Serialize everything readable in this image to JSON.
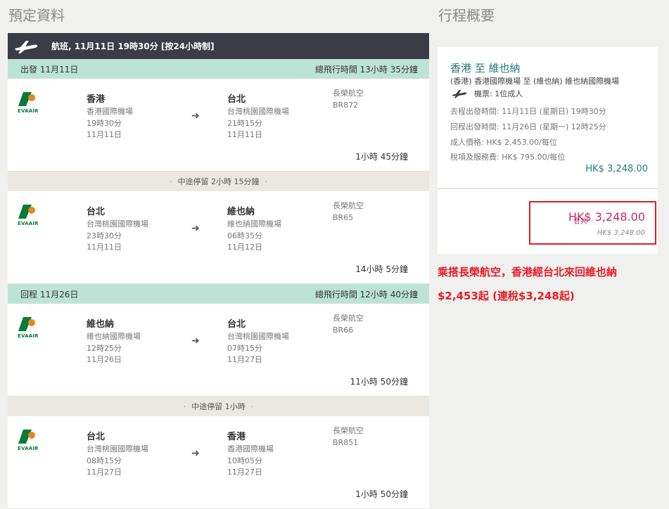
{
  "titles": {
    "booking": "預定資料",
    "summary": "行程概要"
  },
  "flight_header": {
    "text": "航班, 11月11日 19時30分 [按24小時制]"
  },
  "legs": [
    {
      "label": "出發 11月11日",
      "total_time": "總飛行時間 13小時 35分鐘",
      "segments": [
        {
          "logo": "EVAAIR",
          "from_city": "香港",
          "from_airport": "香港國際機場",
          "from_time": "19時30分",
          "from_date": "11月11日",
          "to_city": "台北",
          "to_airport": "台灣桃園國際機場",
          "to_time": "21時15分",
          "to_date": "11月11日",
          "airline": "長榮航空",
          "flight_no": "BR872",
          "duration": "1小時 45分鐘"
        },
        {
          "logo": "EVAAIR",
          "from_city": "台北",
          "from_airport": "台灣桃園國際機場",
          "from_time": "23時30分",
          "from_date": "11月11日",
          "to_city": "維也納",
          "to_airport": "維也納國際機場",
          "to_time": "06時35分",
          "to_date": "11月12日",
          "airline": "長榮航空",
          "flight_no": "BR65",
          "duration": "14小時 5分鐘"
        }
      ],
      "stopover": "中途停留 2小時 15分鐘"
    },
    {
      "label": "回程 11月26日",
      "total_time": "總飛行時間 12小時 40分鐘",
      "segments": [
        {
          "logo": "EVAAIR",
          "from_city": "維也納",
          "from_airport": "維也納國際機場",
          "from_time": "12時25分",
          "from_date": "11月26日",
          "to_city": "台北",
          "to_airport": "台灣桃園國際機場",
          "to_time": "07時15分",
          "to_date": "11月27日",
          "airline": "長榮航空",
          "flight_no": "BR66",
          "duration": "11小時 50分鐘"
        },
        {
          "logo": "EVAAIR",
          "from_city": "台北",
          "from_airport": "台灣桃園國際機場",
          "from_time": "08時15分",
          "from_date": "11月27日",
          "to_city": "香港",
          "to_airport": "香港國際機場",
          "to_time": "10時05分",
          "to_date": "11月27日",
          "airline": "長榮航空",
          "flight_no": "BR851",
          "duration": "1小時 50分鐘"
        }
      ],
      "stopover": "中途停留 1小時"
    }
  ],
  "summary": {
    "route": "香港  至  維也納",
    "route_detail": "(香港) 香港國際機場  至  (維也納) 維也納國際機場",
    "passengers": "機票: 1位成人",
    "outbound": "去程出發時間: 11月11日 (星期日) 19時30分",
    "inbound": "回程出發時間: 11月26日 (星期一) 12時25分",
    "adult_price": "成人價格: HK$ 2,453.00/每位",
    "tax": "稅項及服務費: HK$ 795.00/每位",
    "subtotal": "HK$ 3,248.00",
    "total_label": "合共",
    "total": "HK$ 3,248.00",
    "total_sub": "HK$ 3,248.00"
  },
  "promo": {
    "line1": "乘搭長榮航空，香港經台北來回維也納",
    "line2": "$2,453起 (連稅$3,248起)"
  },
  "colors": {
    "teal": "#1f7d78",
    "leg_header": "#bde3d7",
    "dark_header": "#3a3d46",
    "promo_red": "#e31e24",
    "total_pink": "#c62a6b"
  }
}
